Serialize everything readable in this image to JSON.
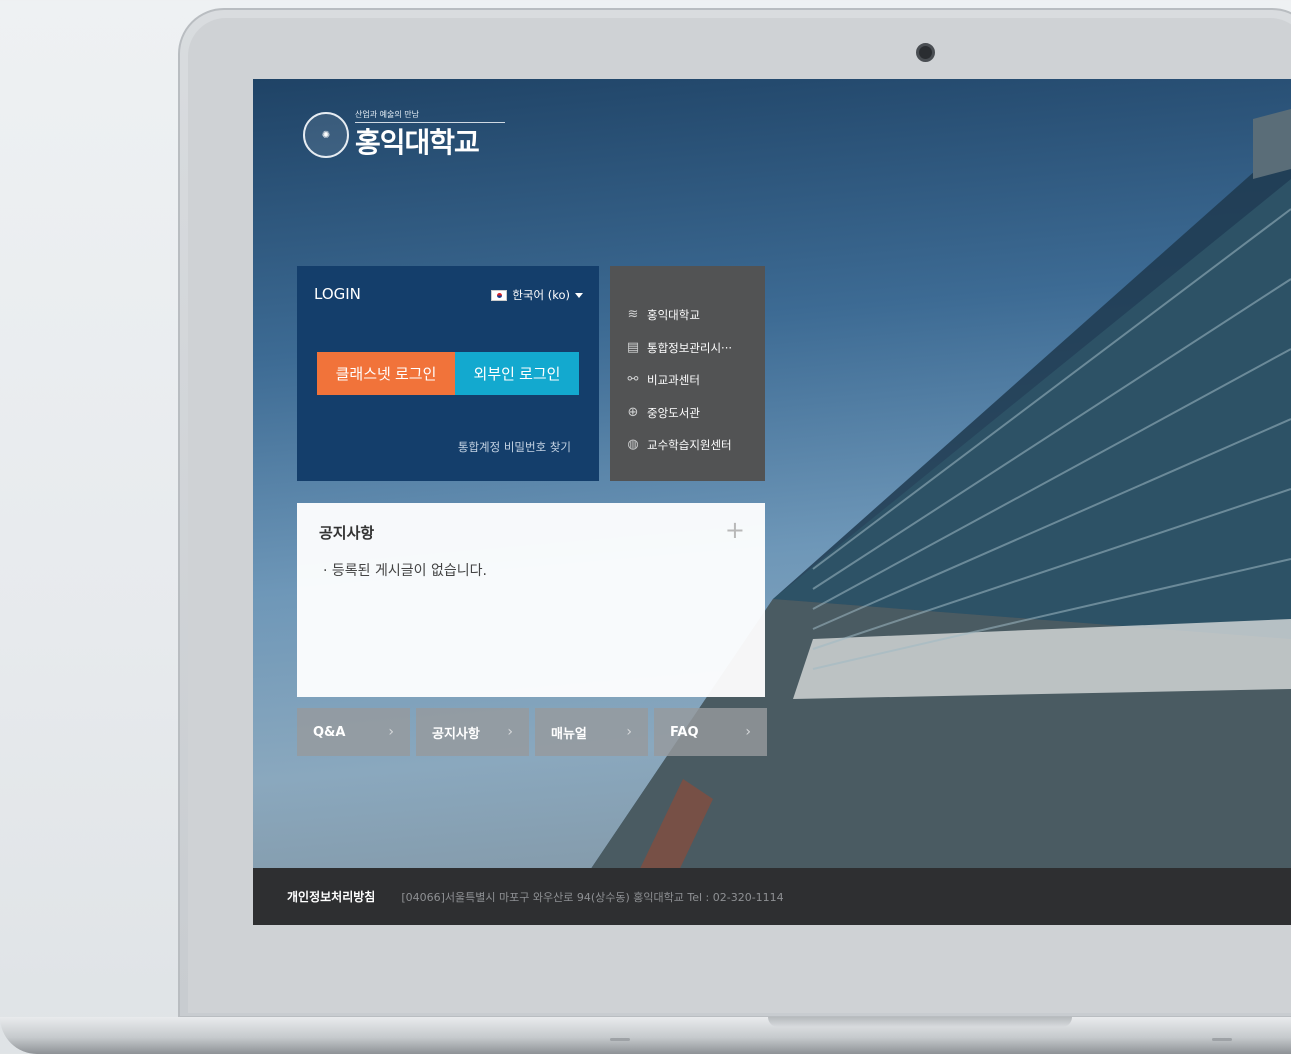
{
  "logo": {
    "tagline": "산업과 예술의 만남",
    "name": "홍익대학교"
  },
  "login": {
    "title": "LOGIN",
    "language": "한국어 (ko)",
    "classnet_button": "클래스넷 로그인",
    "external_button": "외부인 로그인",
    "password_link": "통합계정 비밀번호 찾기"
  },
  "quick_links": [
    {
      "label": "홍익대학교",
      "icon": "layers-icon"
    },
    {
      "label": "통합정보관리시···",
      "icon": "calendar-icon"
    },
    {
      "label": "비교과센터",
      "icon": "link-icon"
    },
    {
      "label": "중앙도서관",
      "icon": "crosshair-icon"
    },
    {
      "label": "교수학습지원센터",
      "icon": "globe-icon"
    }
  ],
  "notice": {
    "title": "공지사항",
    "empty_message": "· 등록된 게시글이 없습니다."
  },
  "bottom_buttons": [
    {
      "label": "Q&A"
    },
    {
      "label": "공지사항"
    },
    {
      "label": "매뉴얼"
    },
    {
      "label": "FAQ"
    }
  ],
  "footer": {
    "privacy": "개인정보처리방침",
    "address": "[04066]서울특별시 마포구 와우산로 94(상수동) 홍익대학교   Tel : 02-320-1114"
  },
  "colors": {
    "login_bg": "#143e6b",
    "classnet": "#f1733a",
    "external": "#13a9cf",
    "quick_links_bg": "#525354",
    "footer_bg": "#2e2f31"
  }
}
